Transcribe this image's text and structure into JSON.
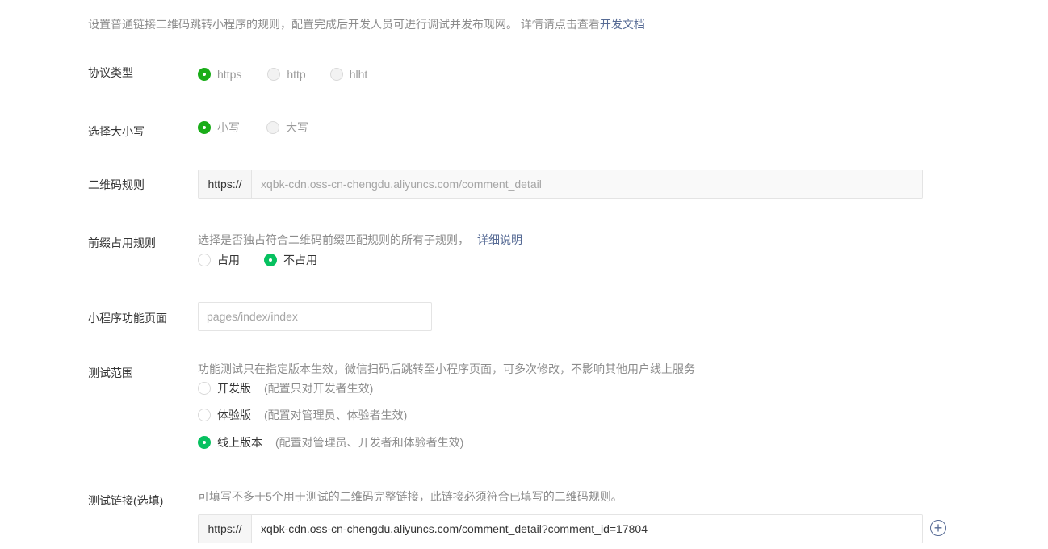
{
  "intro": {
    "text": "设置普通链接二维码跳转小程序的规则，配置完成后开发人员可进行调试并发布现网。 详情请点击查看",
    "link": "开发文档"
  },
  "protocol": {
    "label": "协议类型",
    "options": [
      "https",
      "http",
      "hlht"
    ],
    "selected": "https"
  },
  "case": {
    "label": "选择大小写",
    "options": [
      "小写",
      "大写"
    ],
    "selected": "小写"
  },
  "qr_rule": {
    "label": "二维码规则",
    "prefix": "https://",
    "value": "xqbk-cdn.oss-cn-chengdu.aliyuncs.com/comment_detail"
  },
  "prefix_rule": {
    "label": "前缀占用规则",
    "description": "选择是否独占符合二维码前缀匹配规则的所有子规则，",
    "link": "详细说明",
    "options": [
      "占用",
      "不占用"
    ],
    "selected": "不占用"
  },
  "page": {
    "label": "小程序功能页面",
    "placeholder": "pages/index/index"
  },
  "test_scope": {
    "label": "测试范围",
    "description": "功能测试只在指定版本生效，微信扫码后跳转至小程序页面，可多次修改，不影响其他用户线上服务",
    "options": [
      {
        "label": "开发版",
        "note": "(配置只对开发者生效)"
      },
      {
        "label": "体验版",
        "note": "(配置对管理员、体验者生效)"
      },
      {
        "label": "线上版本",
        "note": "(配置对管理员、开发者和体验者生效)"
      }
    ],
    "selected": "线上版本"
  },
  "test_link": {
    "label": "测试链接(选填)",
    "description": "可填写不多于5个用于测试的二维码完整链接，此链接必须符合已填写的二维码规则。",
    "prefix": "https://",
    "value": "xqbk-cdn.oss-cn-chengdu.aliyuncs.com/comment_detail?comment_id=17804",
    "add_icon": "+"
  },
  "colors": {
    "accent_green": "#07c160",
    "link_blue": "#576b95"
  }
}
